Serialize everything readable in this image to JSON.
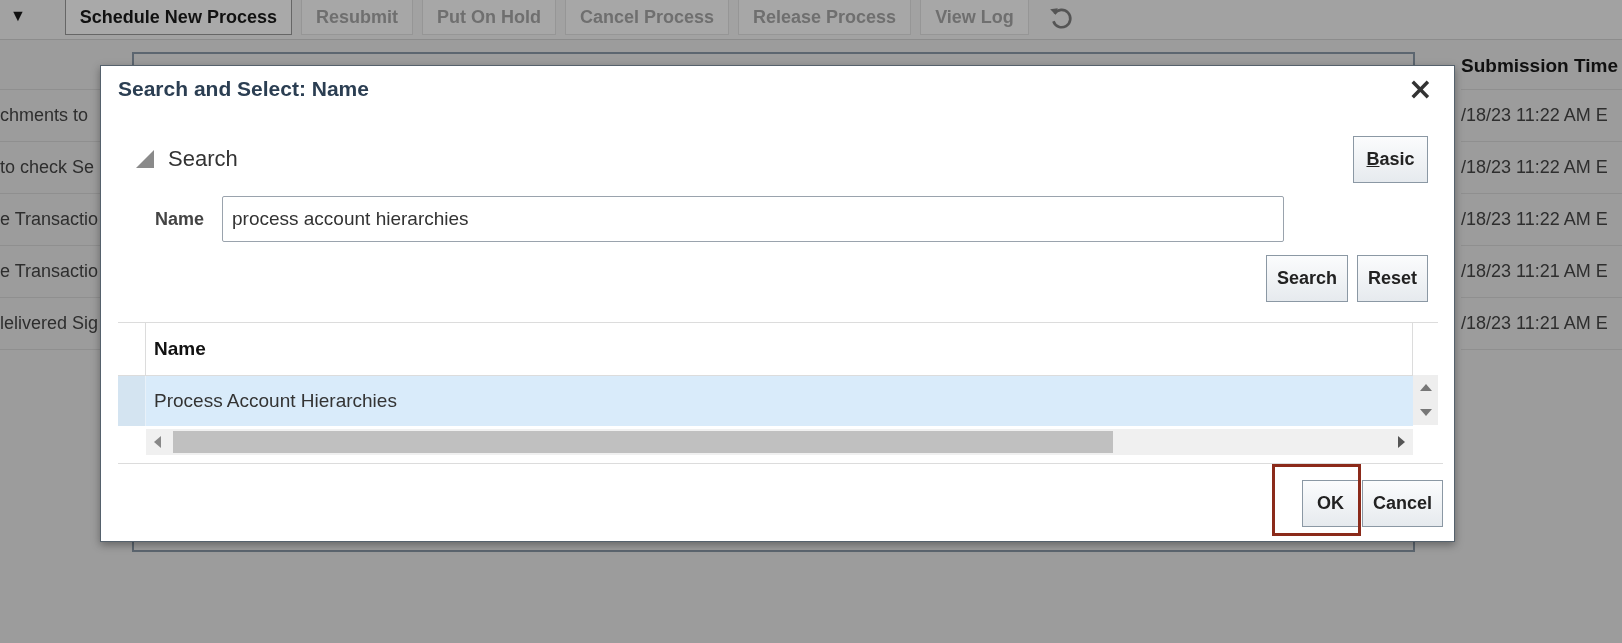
{
  "toolbar": {
    "menu_caret": "▼",
    "buttons": [
      {
        "label": "Schedule New Process",
        "disabled": false
      },
      {
        "label": "Resubmit",
        "disabled": true
      },
      {
        "label": "Put On Hold",
        "disabled": true
      },
      {
        "label": "Cancel Process",
        "disabled": true
      },
      {
        "label": "Release Process",
        "disabled": true
      },
      {
        "label": "View Log",
        "disabled": true
      }
    ]
  },
  "table": {
    "columns": [
      {
        "label": "Submission Time"
      }
    ],
    "rows": [
      {
        "name": "chments to",
        "time": "/18/23 11:22 AM E"
      },
      {
        "name": "to check Se",
        "time": "/18/23 11:22 AM E"
      },
      {
        "name": "e Transactio",
        "time": "/18/23 11:22 AM E"
      },
      {
        "name": "e Transactio",
        "time": "/18/23 11:21 AM E"
      },
      {
        "name": "lelivered Sig",
        "time": "/18/23 11:21 AM E"
      }
    ]
  },
  "dialog": {
    "title": "Search and Select: Name",
    "close": "×",
    "search": {
      "label": "Search",
      "expanded": true,
      "mode_button": "Basic",
      "fields": [
        {
          "label": "Name",
          "value": "process account hierarchies"
        }
      ],
      "buttons": [
        "Search",
        "Reset"
      ]
    },
    "results": {
      "columns": [
        {
          "label": "Name"
        }
      ],
      "rows": [
        {
          "name": "Process Account Hierarchies",
          "selected": true
        }
      ]
    },
    "buttons": [
      {
        "label": "OK",
        "highlighted": true
      },
      {
        "label": "Cancel",
        "highlighted": false
      }
    ]
  }
}
